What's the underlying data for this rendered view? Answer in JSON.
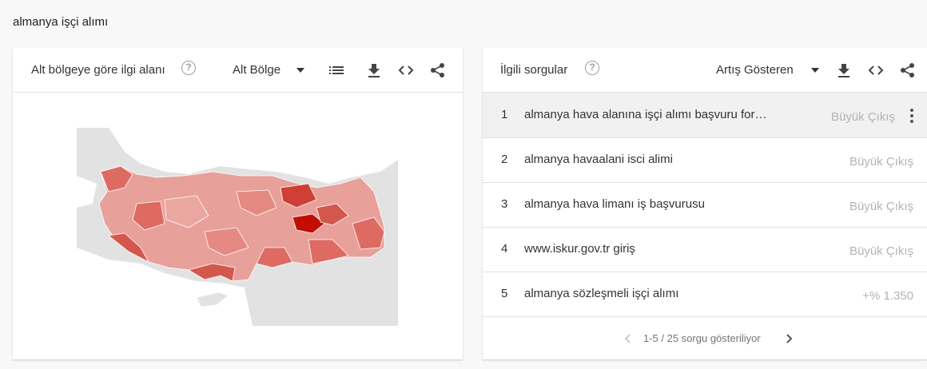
{
  "search_term": "almanya işçi alımı",
  "region_card": {
    "title": "Alt bölgeye göre ilgi alanı",
    "help": "?",
    "select_label": "Alt Bölge",
    "icons": [
      "list-icon",
      "download-icon",
      "embed-icon",
      "share-icon"
    ],
    "map": {
      "country": "Türkiye",
      "colors": {
        "land": "#e0e0e0",
        "low": "#ee9e98",
        "mid": "#dd6b62",
        "high": "#c93b30",
        "top": "#c20d00"
      }
    }
  },
  "queries_card": {
    "title": "İlgili sorgular",
    "help": "?",
    "select_label": "Artış Gösteren",
    "rows": [
      {
        "rank": "1",
        "query": "almanya hava alanına işçi alımı başvuru for…",
        "value": "Büyük Çıkış"
      },
      {
        "rank": "2",
        "query": "almanya havaalani isci alimi",
        "value": "Büyük Çıkış"
      },
      {
        "rank": "3",
        "query": "almanya hava limanı iş başvurusu",
        "value": "Büyük Çıkış"
      },
      {
        "rank": "4",
        "query": "www.iskur.gov.tr giriş",
        "value": "Büyük Çıkış"
      },
      {
        "rank": "5",
        "query": "almanya sözleşmeli işçi alımı",
        "value": "+% 1.350"
      }
    ],
    "pager_text": "1-5 / 25 sorgu gösteriliyor"
  }
}
